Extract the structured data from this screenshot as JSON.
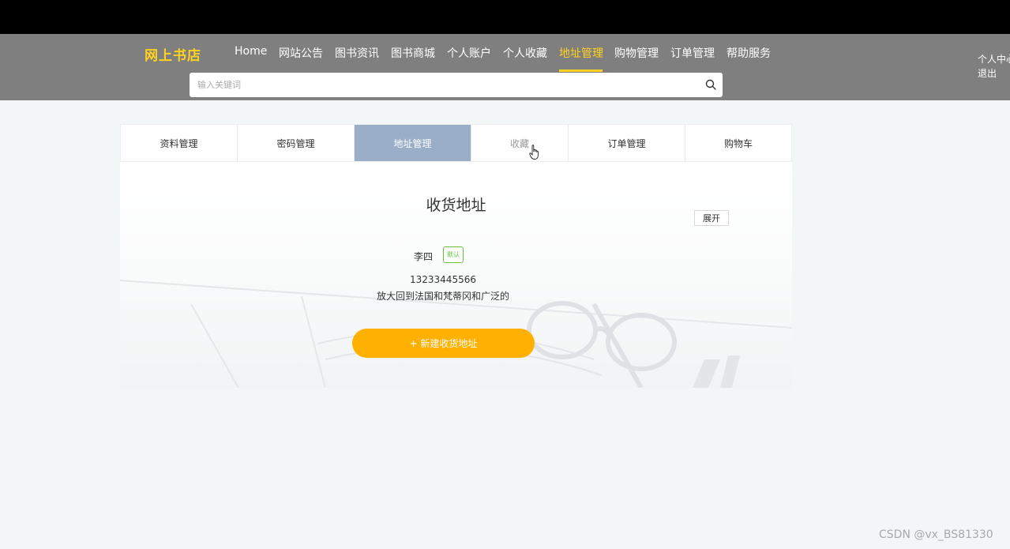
{
  "site": {
    "logo": "网上书店"
  },
  "nav": {
    "items": [
      {
        "label": "Home",
        "active": false
      },
      {
        "label": "网站公告",
        "active": false
      },
      {
        "label": "图书资讯",
        "active": false
      },
      {
        "label": "图书商城",
        "active": false
      },
      {
        "label": "个人账户",
        "active": false
      },
      {
        "label": "个人收藏",
        "active": false
      },
      {
        "label": "地址管理",
        "active": true
      },
      {
        "label": "购物管理",
        "active": false
      },
      {
        "label": "订单管理",
        "active": false
      },
      {
        "label": "帮助服务",
        "active": false
      }
    ],
    "user_center": "个人中心",
    "logout": "退出"
  },
  "search": {
    "placeholder": "输入关键词",
    "value": "",
    "icon": "search-icon"
  },
  "tabs": [
    {
      "label": "资料管理",
      "state": "normal"
    },
    {
      "label": "密码管理",
      "state": "normal"
    },
    {
      "label": "地址管理",
      "state": "active"
    },
    {
      "label": "收藏",
      "state": "hover"
    },
    {
      "label": "订单管理",
      "state": "normal"
    },
    {
      "label": "购物车",
      "state": "normal"
    }
  ],
  "address": {
    "title": "收货地址",
    "expand_label": "展开",
    "entry": {
      "name": "李四",
      "badge": "默认",
      "phone": "13233445566",
      "address": "放大回到法国和梵蒂冈和广泛的"
    },
    "new_button": "+ 新建收货地址"
  },
  "watermark": "CSDN @vx_BS81330",
  "colors": {
    "header_bg": "#7f7f7f",
    "brand_yellow": "#ffd21e",
    "active_tab_bg": "#9aaec8",
    "button_orange": "#ffb000",
    "badge_green": "#67c23a"
  }
}
